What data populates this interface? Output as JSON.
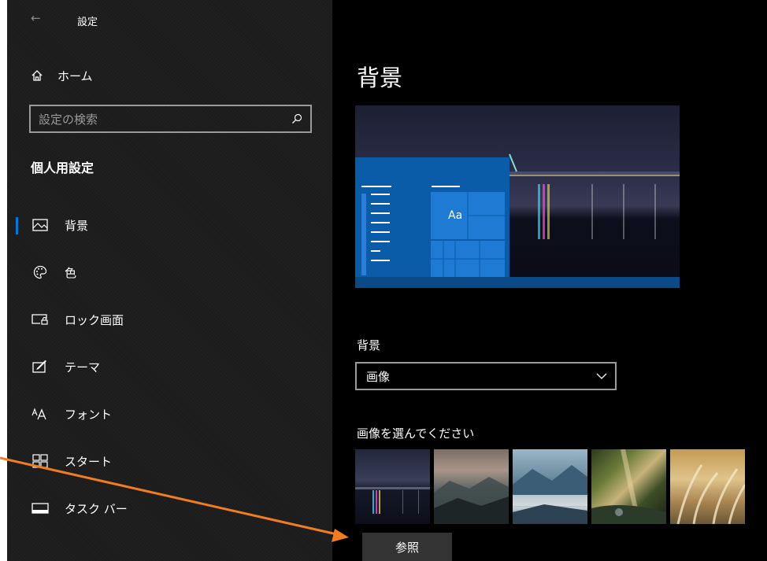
{
  "window": {
    "title": "設定",
    "back_icon": "back-arrow-icon"
  },
  "sidebar": {
    "home_label": "ホーム",
    "search_placeholder": "設定の検索",
    "section_heading": "個人用設定",
    "items": [
      {
        "label": "背景",
        "icon": "picture-icon",
        "selected": true
      },
      {
        "label": "色",
        "icon": "palette-icon",
        "selected": false
      },
      {
        "label": "ロック画面",
        "icon": "lock-screen-icon",
        "selected": false
      },
      {
        "label": "テーマ",
        "icon": "theme-icon",
        "selected": false
      },
      {
        "label": "フォント",
        "icon": "font-icon",
        "selected": false
      },
      {
        "label": "スタート",
        "icon": "start-icon",
        "selected": false
      },
      {
        "label": "タスク バー",
        "icon": "taskbar-icon",
        "selected": false
      }
    ]
  },
  "main": {
    "page_title": "背景",
    "preview": {
      "sample_text": "Aa"
    },
    "background_label": "背景",
    "background_value": "画像",
    "choose_label": "画像を選んでください",
    "browse_label": "参照"
  },
  "colors": {
    "accent": "#0078d7",
    "sidebar_bg": "#1c1c1c",
    "main_bg": "#000000",
    "annotation_arrow": "#f07d22"
  }
}
